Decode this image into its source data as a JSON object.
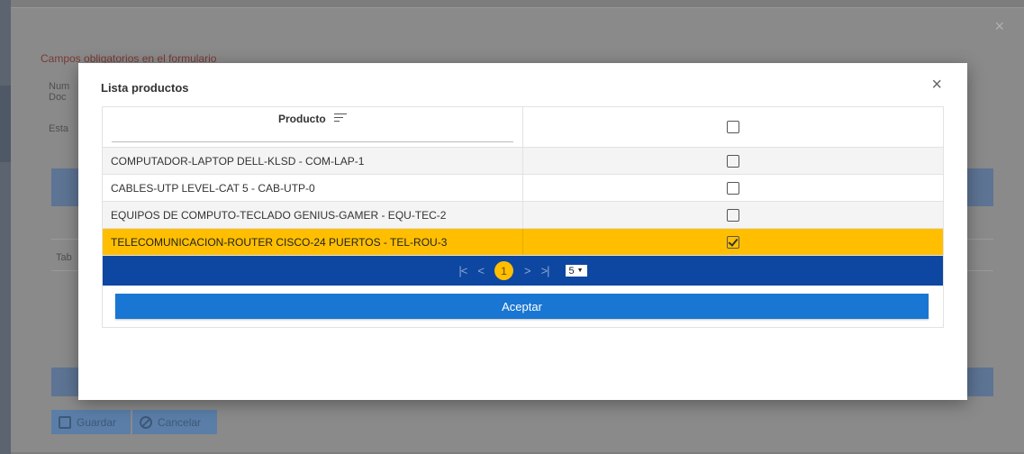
{
  "background": {
    "required_notice": "Campos obligatorios en el formulario",
    "labels": [
      "Num",
      "Doc",
      "Esta",
      "Tab"
    ],
    "buttons": {
      "save_label": "Guardar",
      "cancel_label": "Cancelar"
    },
    "close_icon": "close-icon"
  },
  "modal": {
    "title": "Lista productos",
    "close_glyph": "×",
    "table": {
      "column_product": "Producto",
      "rows": [
        {
          "product": "COMPUTADOR-LAPTOP DELL-KLSD - COM-LAP-1",
          "checked": false,
          "selected": false
        },
        {
          "product": "CABLES-UTP LEVEL-CAT 5 - CAB-UTP-0",
          "checked": false,
          "selected": false
        },
        {
          "product": "EQUIPOS DE COMPUTO-TECLADO GENIUS-GAMER - EQU-TEC-2",
          "checked": false,
          "selected": false
        },
        {
          "product": "TELECOMUNICACION-ROUTER CISCO-24 PUERTOS - TEL-ROU-3",
          "checked": true,
          "selected": true
        }
      ]
    },
    "paginator": {
      "first": "|<",
      "prev": "<",
      "current_page": "1",
      "next": ">",
      "last": ">|",
      "rows_per_page": "5"
    },
    "accept_label": "Aceptar"
  },
  "colors": {
    "paginator_bg": "#0d47a1",
    "selected_row": "#ffbf00",
    "accept_button": "#1976d2"
  }
}
